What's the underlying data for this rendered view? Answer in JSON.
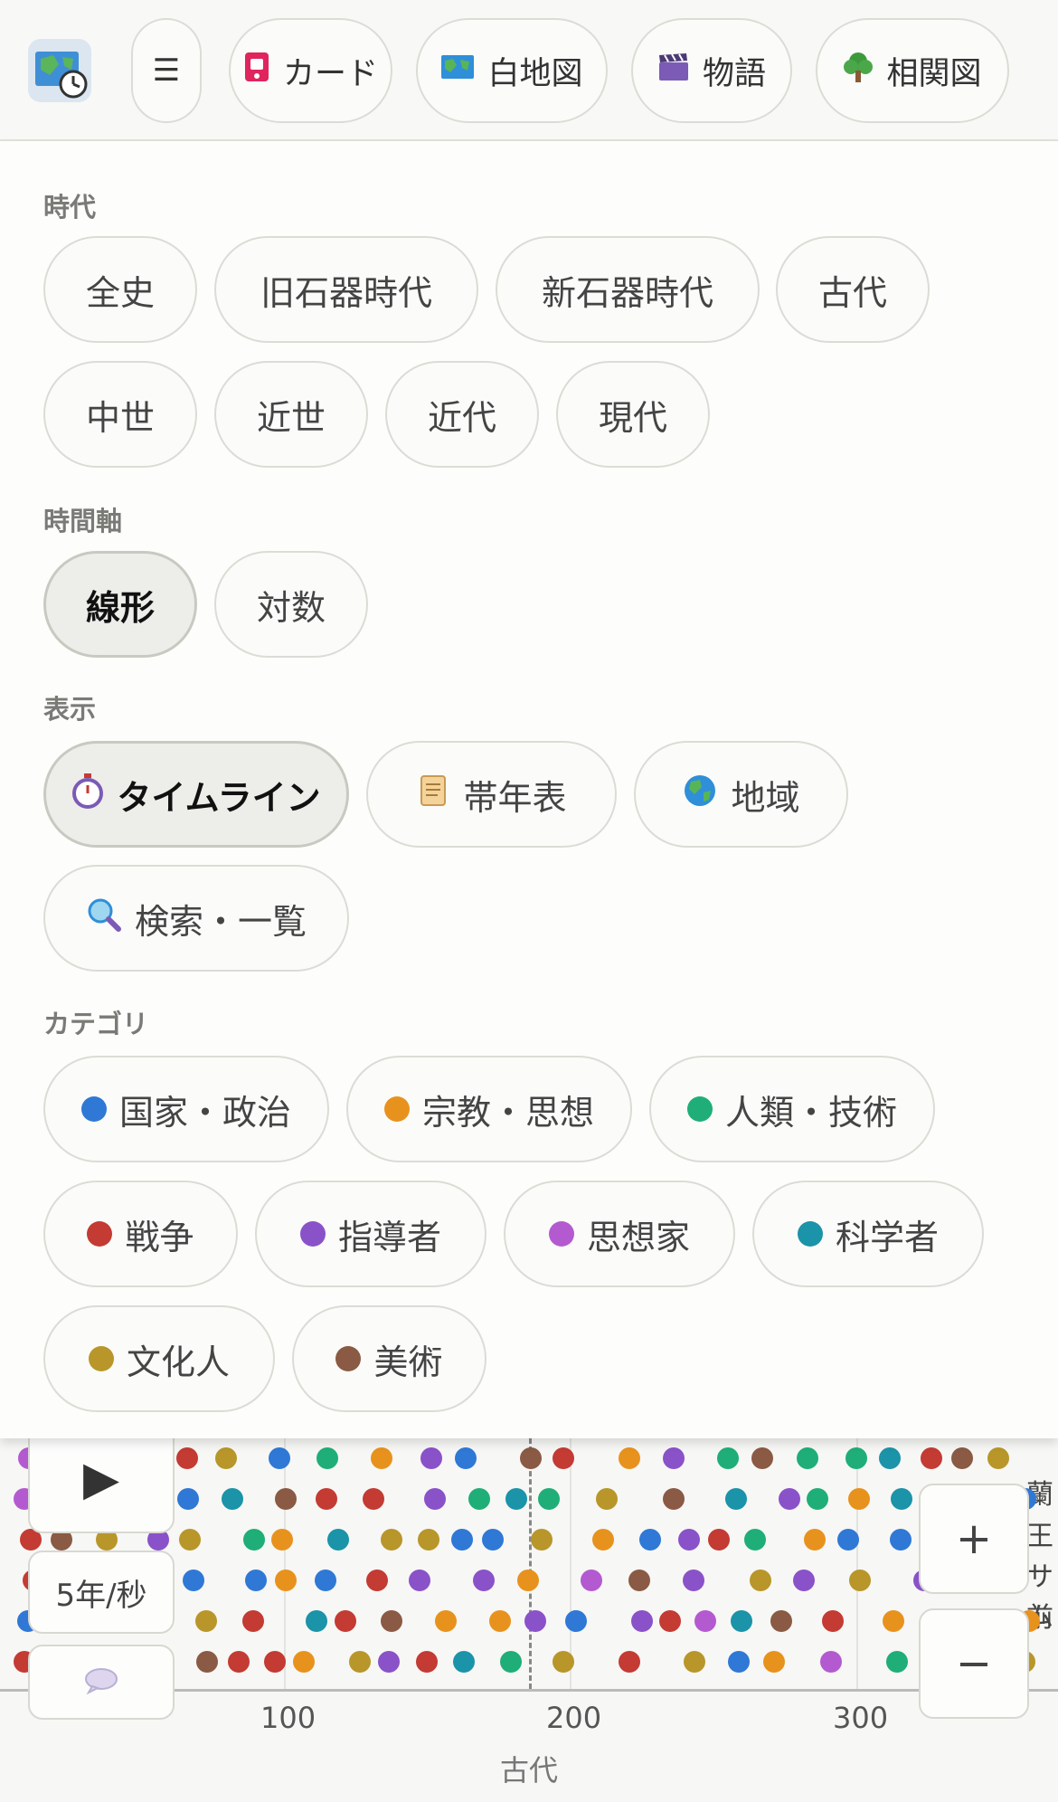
{
  "app": {
    "icon": "map-clock-icon"
  },
  "toolbar": {
    "menu_icon": "☰",
    "buttons": [
      {
        "label": "カード",
        "icon": "card-icon",
        "color": "#e0245e"
      },
      {
        "label": "白地図",
        "icon": "map-icon",
        "color": "#2f8fd8"
      },
      {
        "label": "物語",
        "icon": "clapper-board-icon",
        "color": "#7b5bb5"
      },
      {
        "label": "相関図",
        "icon": "tree-icon",
        "color": "#3c9a3c"
      }
    ]
  },
  "panel": {
    "era": {
      "label": "時代",
      "options": [
        "全史",
        "旧石器時代",
        "新石器時代",
        "古代",
        "中世",
        "近世",
        "近代",
        "現代"
      ]
    },
    "time_axis": {
      "label": "時間軸",
      "options": [
        "線形",
        "対数"
      ],
      "selected": "線形"
    },
    "display": {
      "label": "表示",
      "options": [
        {
          "label": "タイムライン",
          "icon": "stopwatch-icon"
        },
        {
          "label": "帯年表",
          "icon": "scroll-icon"
        },
        {
          "label": "地域",
          "icon": "globe-icon"
        },
        {
          "label": "検索・一覧",
          "icon": "magnifier-icon"
        }
      ],
      "selected": "タイムライン"
    },
    "category": {
      "label": "カテゴリ",
      "options": [
        {
          "label": "国家・政治",
          "color": "#2f78d6"
        },
        {
          "label": "宗教・思想",
          "color": "#e8921e"
        },
        {
          "label": "人類・技術",
          "color": "#1fae78"
        },
        {
          "label": "戦争",
          "color": "#c33b33"
        },
        {
          "label": "指導者",
          "color": "#8a52c9"
        },
        {
          "label": "思想家",
          "color": "#b45ad0"
        },
        {
          "label": "科学者",
          "color": "#1b93a8"
        },
        {
          "label": "文化人",
          "color": "#b8962a"
        },
        {
          "label": "美術",
          "color": "#8a5a44"
        }
      ]
    }
  },
  "timeline": {
    "speed": "5年/秒",
    "play_icon": "▶",
    "zoom_in": "+",
    "zoom_out": "−",
    "comment_icon": "speech-bubble-icon",
    "ticks": [
      "100",
      "200",
      "300"
    ],
    "era_label": "古代",
    "edge_labels": [
      "蘭",
      "王",
      "サム",
      "前"
    ]
  }
}
